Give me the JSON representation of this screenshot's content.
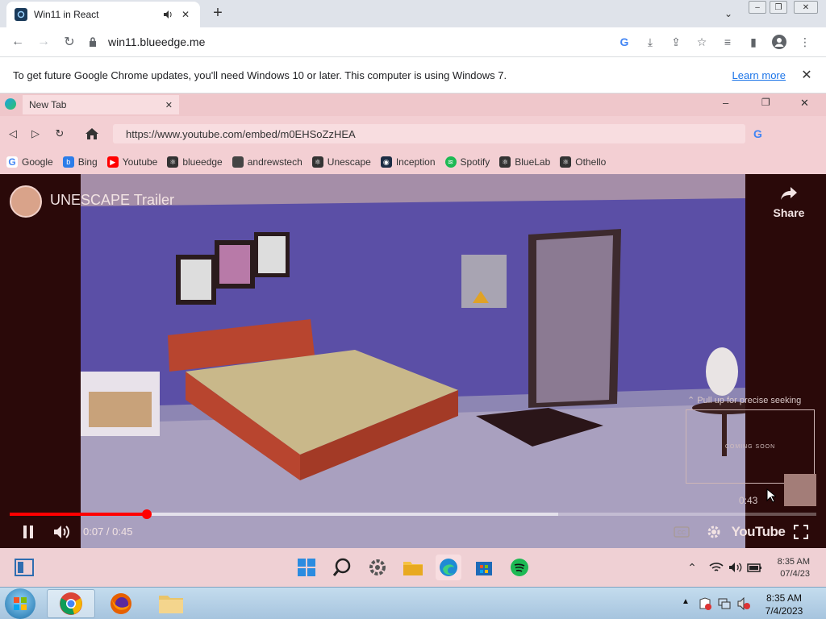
{
  "chrome": {
    "tab_title": "Win11 in React",
    "url": "win11.blueedge.me"
  },
  "infobar": {
    "message": "To get future Google Chrome updates, you'll need Windows 10 or later. This computer is using Windows 7.",
    "learn_more": "Learn more"
  },
  "inner_browser": {
    "tab_title": "New Tab",
    "url": "https://www.youtube.com/embed/m0EHSoZzHEA",
    "bookmarks": [
      {
        "label": "Google",
        "icon": "google-icon",
        "color": "#4285f4"
      },
      {
        "label": "Bing",
        "icon": "bing-icon",
        "color": "#2b7de9"
      },
      {
        "label": "Youtube",
        "icon": "youtube-icon",
        "color": "#ff0000"
      },
      {
        "label": "blueedge",
        "icon": "react-icon",
        "color": "#333333"
      },
      {
        "label": "andrewstech",
        "icon": "andrewstech-icon",
        "color": "#444444"
      },
      {
        "label": "Unescape",
        "icon": "react-icon",
        "color": "#333333"
      },
      {
        "label": "Inception",
        "icon": "inception-icon",
        "color": "#1c2c44"
      },
      {
        "label": "Spotify",
        "icon": "spotify-icon",
        "color": "#1db954"
      },
      {
        "label": "BlueLab",
        "icon": "react-icon",
        "color": "#333333"
      },
      {
        "label": "Othello",
        "icon": "react-icon",
        "color": "#333333"
      }
    ]
  },
  "video": {
    "title": "UNESCAPE Trailer",
    "share_label": "Share",
    "seek_hint": "Pull up for precise seeking",
    "preview_text": "COMING SOON",
    "preview_time": "0:43",
    "current_time": "0:07",
    "duration": "0:45",
    "time_display": "0:07 / 0:45",
    "played_fraction": 0.17,
    "buffered_fraction": 0.68,
    "youtube_logo": "YouTube"
  },
  "win11_taskbar": {
    "time": "8:35 AM",
    "date": "07/4/23"
  },
  "win7_taskbar": {
    "time": "8:35 AM",
    "date": "7/4/2023"
  },
  "colors": {
    "youtube_red": "#ff0000",
    "wall_blue": "#5b4fa6",
    "accent_link": "#1a73e8"
  }
}
